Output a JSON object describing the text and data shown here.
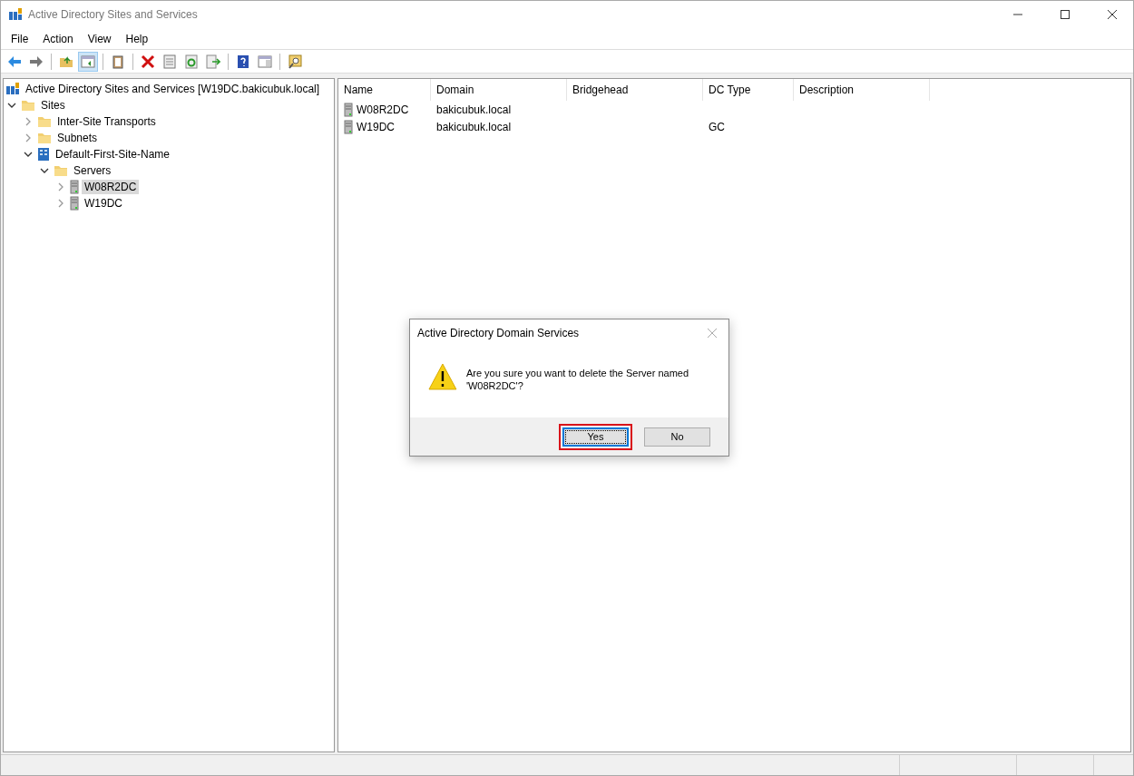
{
  "window": {
    "title": "Active Directory Sites and Services"
  },
  "menu": [
    "File",
    "Action",
    "View",
    "Help"
  ],
  "toolbar": [
    {
      "kind": "back",
      "pressed": false
    },
    {
      "kind": "forward",
      "pressed": false
    },
    {
      "kind": "sep"
    },
    {
      "kind": "up",
      "pressed": false
    },
    {
      "kind": "tree",
      "pressed": true
    },
    {
      "kind": "sep"
    },
    {
      "kind": "clipboard",
      "pressed": false
    },
    {
      "kind": "sep"
    },
    {
      "kind": "delete",
      "pressed": false
    },
    {
      "kind": "properties",
      "pressed": false
    },
    {
      "kind": "refresh",
      "pressed": false
    },
    {
      "kind": "export",
      "pressed": false
    },
    {
      "kind": "sep"
    },
    {
      "kind": "help",
      "pressed": false
    },
    {
      "kind": "panel",
      "pressed": false
    },
    {
      "kind": "sep"
    },
    {
      "kind": "find",
      "pressed": false
    }
  ],
  "tree": [
    {
      "label": "Active Directory Sites and Services [W19DC.bakicubuk.local]",
      "kind": "directory",
      "selected": false,
      "children": [
        {
          "label": "Sites",
          "kind": "folder",
          "expanded": true,
          "selected": false,
          "children": [
            {
              "label": "Inter-Site Transports",
              "kind": "folder",
              "expanded": false,
              "selected": false
            },
            {
              "label": "Subnets",
              "kind": "folder",
              "expanded": false,
              "selected": false
            },
            {
              "label": "Default-First-Site-Name",
              "kind": "site",
              "expanded": true,
              "selected": false,
              "children": [
                {
                  "label": "Servers",
                  "kind": "folder",
                  "expanded": true,
                  "selected": false,
                  "children": [
                    {
                      "label": "W08R2DC",
                      "kind": "server",
                      "expanded": false,
                      "selected": true
                    },
                    {
                      "label": "W19DC",
                      "kind": "server",
                      "expanded": false,
                      "selected": false
                    }
                  ]
                }
              ]
            }
          ]
        }
      ]
    }
  ],
  "list": {
    "columns": [
      "Name",
      "Domain",
      "Bridgehead",
      "DC Type",
      "Description"
    ],
    "rows": [
      [
        "W08R2DC",
        "bakicubuk.local",
        "",
        ""
      ],
      [
        "W19DC",
        "bakicubuk.local",
        "",
        "GC"
      ]
    ]
  },
  "dialog": {
    "title": "Active Directory Domain Services",
    "message": "Are you sure you want to delete the Server named 'W08R2DC'?",
    "buttons": [
      {
        "label": "Yes",
        "selected": true,
        "highlighted": true
      },
      {
        "label": "No",
        "selected": false,
        "highlighted": false
      }
    ]
  }
}
